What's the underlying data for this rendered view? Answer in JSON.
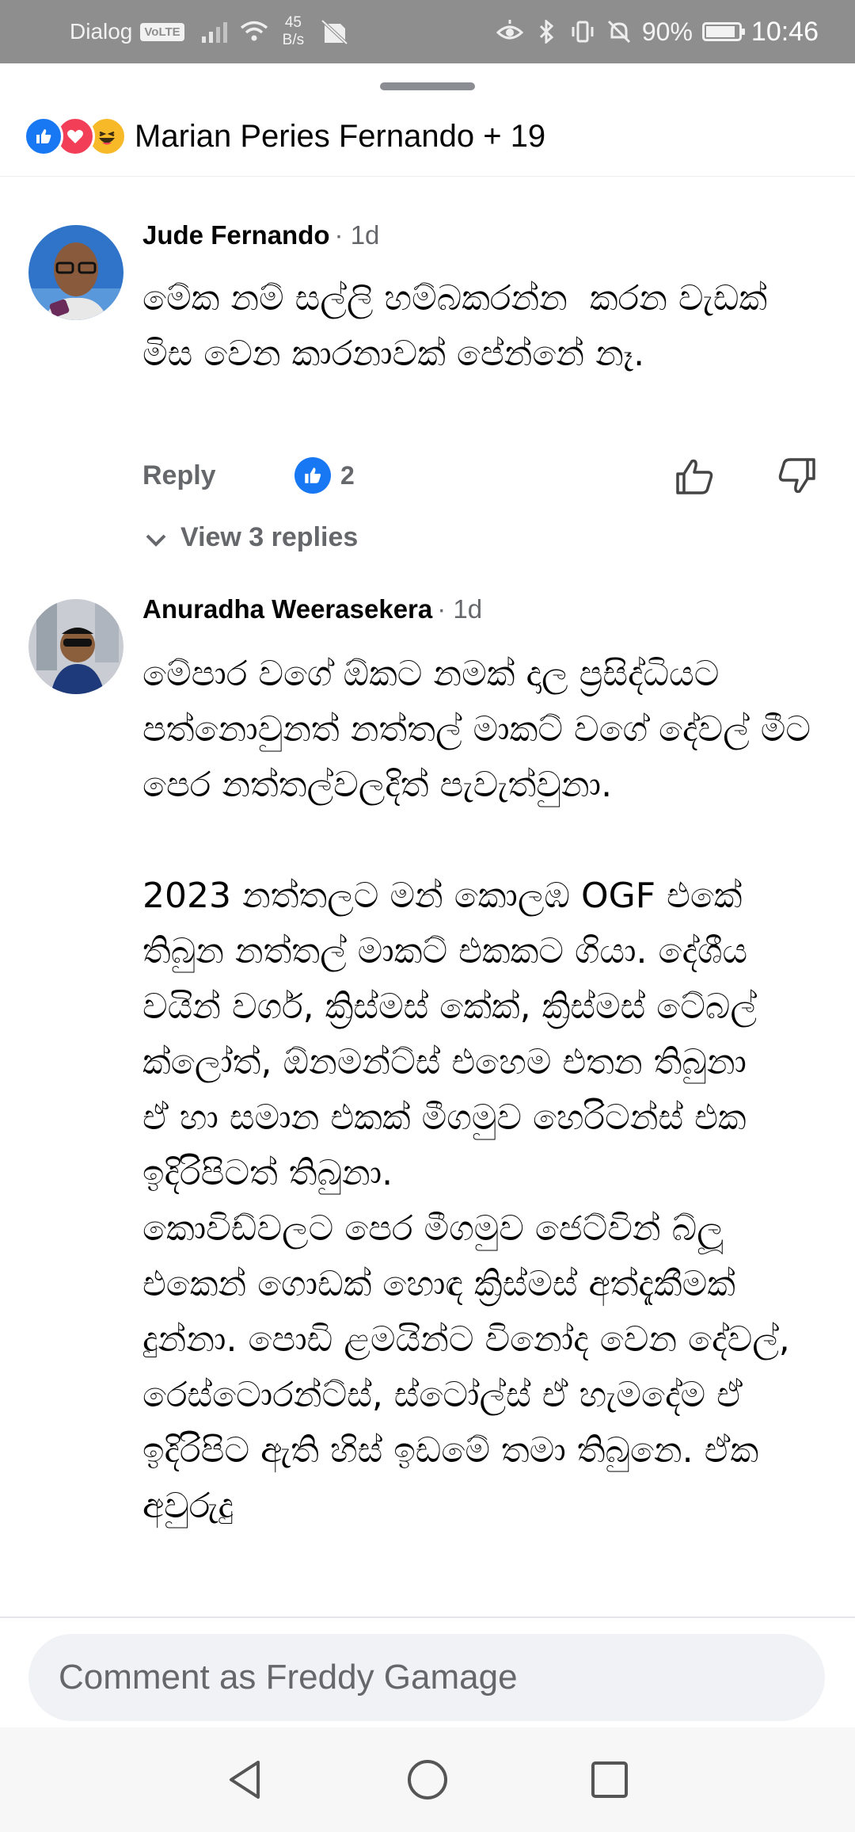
{
  "status_bar": {
    "carrier": "Dialog",
    "volte": "VoLTE",
    "speed_value": "45",
    "speed_unit": "B/s",
    "battery_pct": "90%",
    "battery_level": 0.9,
    "time": "10:46"
  },
  "header": {
    "reactors": "Marian Peries Fernando + 19",
    "reaction_icons": [
      "like-icon",
      "love-icon",
      "haha-icon"
    ]
  },
  "comments": [
    {
      "author": "Jude Fernando",
      "age": "· 1d",
      "text": "මේක නම් සල්ලි හම්බකරන්න  කරන වැඩක් මිස වෙන කාරනාවක් පේන්නේ නෑ.",
      "reply_label": "Reply",
      "like_count": "2",
      "view_replies": "View 3 replies"
    },
    {
      "author": "Anuradha Weerasekera",
      "age": "· 1d",
      "text": "මේපාර වගේ ඕකට නමක් දාල ප්‍රසිද්ධියට පත්නොවුනත් නත්තල් මාකට් වගේ දේවල් මීට පෙර නත්තල්වලදිත් පැවැත්වුනා.\n\n2023 නත්තලට මන් කොලඹ OGF එකේ තිබුන නත්තල් මාකට් එකකට ගියා. දේශීය වයින් වර්ග, ක්‍රිස්මස් කේක්, ක්‍රිස්මස් ටේබල් ක්ලෝත්, ඕනමන්ට්ස් එහෙම එතන තිබුනා\nඒ හා සමාන එකක් මීගමුව හෙරිටන්ස් එක ඉදිරිපිටත් තිබුනා.\nකොවිඩ්වලට පෙර මීගමුව ජෙට්වින් බ්ලූ එකෙන් ගොඩක් හොඳ ක්‍රිස්මස් අත්දැකීමක් දුන්නා. පොඩි ළමයින්ට විනෝද වෙන දේවල්, රෙස්ටොරන්ට්ස්, ස්ටෝල්ස් ඒ හැමදේම ඒ ඉදිරිපිට ඇති හිස් ඉඩමේ තමා තිබුනෙ. ඒක අවුරුදු"
    }
  ],
  "composer": {
    "placeholder": "Comment as Freddy Gamage"
  },
  "colors": {
    "accent": "#1877f2",
    "secondary_text": "#65676b",
    "status_bar": "#8e8e8e",
    "input_bg": "#f0f2f5"
  }
}
